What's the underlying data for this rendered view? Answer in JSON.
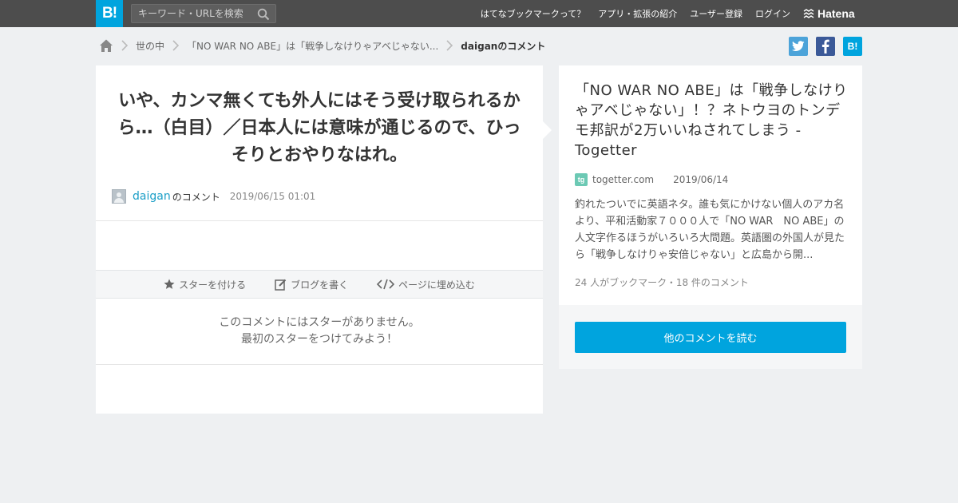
{
  "header": {
    "logo_text": "B!",
    "search_placeholder": "キーワード・URLを検索",
    "nav": [
      "はてなブックマークって？",
      "アプリ・拡張の紹介",
      "ユーザー登録",
      "ログイン"
    ],
    "hatena_label": "Hatena"
  },
  "breadcrumb": {
    "category": "世の中",
    "entry": "「NO WAR NO ABE」は「戦争しなけりゃアベじゃない...",
    "current": "daiganのコメント"
  },
  "share": {
    "b_label": "B!"
  },
  "comment": {
    "text": "いや、カンマ無くても外人にはそう受け取られるから…（白目）／日本人には意味が通じるので、ひっそりとおやりなはれ。",
    "user": "daigan",
    "user_suffix": "のコメント",
    "date": "2019/06/15 01:01"
  },
  "actions": {
    "star": "スターを付ける",
    "blog": "ブログを書く",
    "embed": "ページに埋め込む"
  },
  "no_star": {
    "line1": "このコメントにはスターがありません。",
    "line2": "最初のスターをつけてみよう！"
  },
  "entry": {
    "title": "「NO WAR NO ABE」は「戦争しなけりゃアベじゃない」！？ネトウヨのトンデモ邦訳が2万いいねされてしまう - Togetter",
    "favicon_text": "tg",
    "source": "togetter.com",
    "date": "2019/06/14",
    "summary": "釣れたついでに英語ネタ。誰も気にかけない個人のアカ名より、平和活動家７０００人で「NO WAR　NO ABE」の人文字作るほうがいろいろ大問題。英語圏の外国人が見たら「戦争しなけりゃ安倍じゃない」と広島から開...",
    "count": "24 人がブックマーク・18 件のコメント",
    "more_button": "他のコメントを読む"
  },
  "colors": {
    "brand": "#00a4de",
    "header_bg": "#4d4d4d",
    "twitter": "#4ca3d9",
    "facebook": "#3b5998"
  }
}
